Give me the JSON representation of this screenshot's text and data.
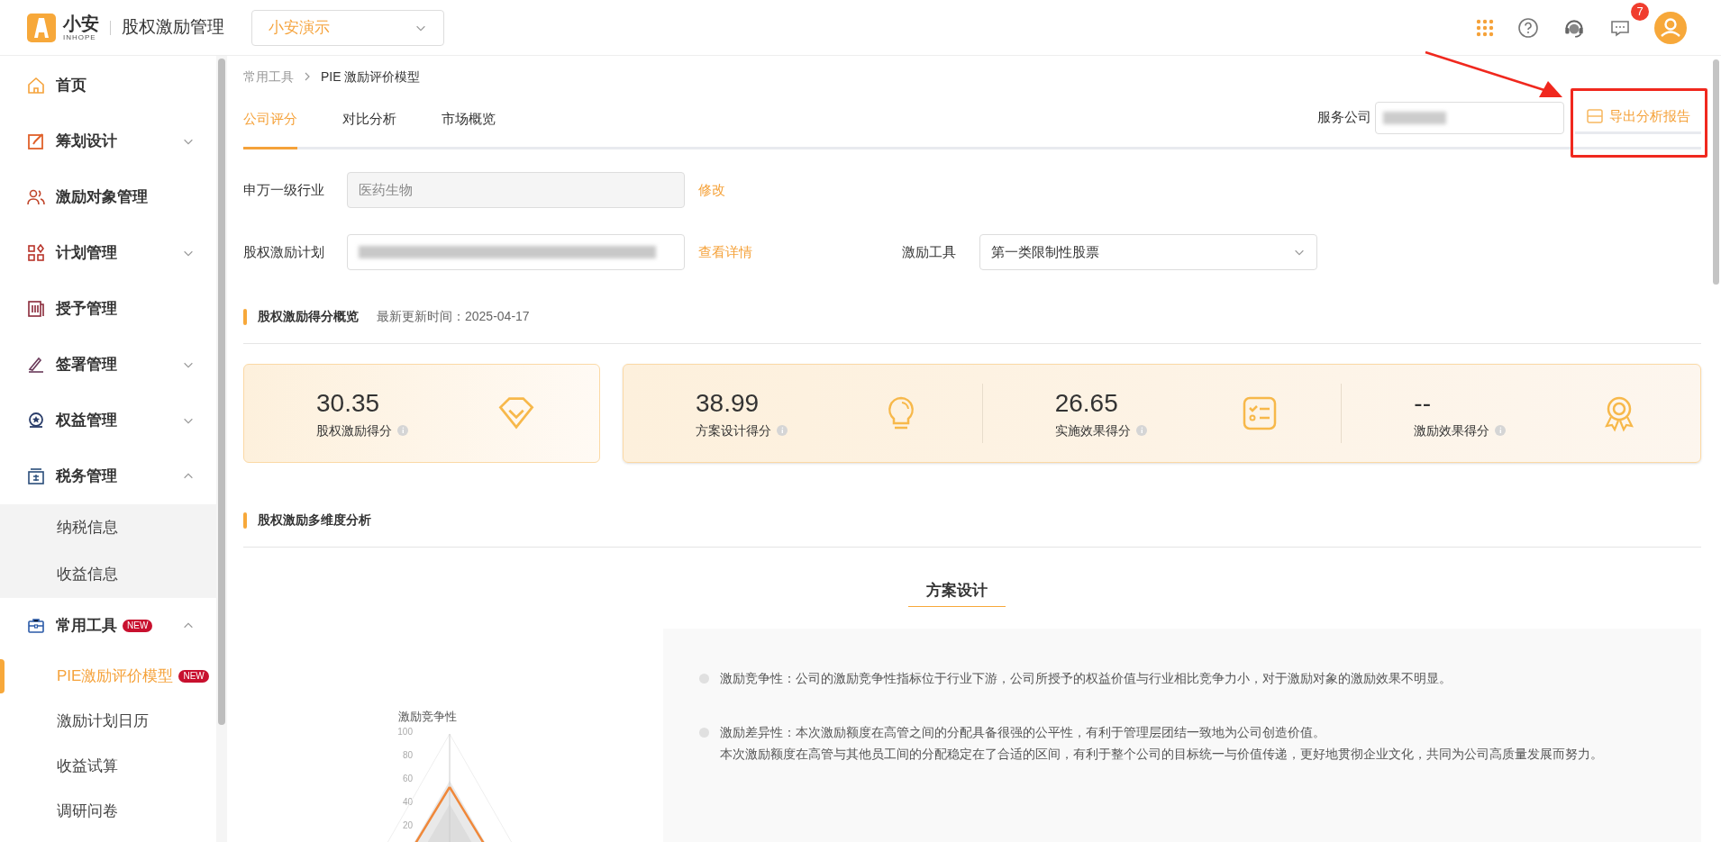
{
  "header": {
    "logo_text": "小安",
    "logo_subtext": "INHOPE",
    "app_title": "股权激励管理",
    "company_select": "小安演示",
    "message_count": "7"
  },
  "sidebar": {
    "items": [
      {
        "label": "首页",
        "selected": false
      },
      {
        "label": "筹划设计",
        "selected": false,
        "expanded": false
      },
      {
        "label": "激励对象管理",
        "selected": false
      },
      {
        "label": "计划管理",
        "selected": false,
        "expanded": false
      },
      {
        "label": "授予管理",
        "selected": false
      },
      {
        "label": "签署管理",
        "selected": false,
        "expanded": false
      },
      {
        "label": "权益管理",
        "selected": false,
        "expanded": false
      },
      {
        "label": "税务管理",
        "selected": false,
        "expanded": true,
        "children": [
          {
            "label": "纳税信息",
            "selected": false
          },
          {
            "label": "收益信息",
            "selected": false
          }
        ]
      },
      {
        "label": "常用工具",
        "selected": false,
        "expanded": true,
        "badge": "NEW",
        "children": [
          {
            "label": "PIE激励评价模型",
            "selected": true,
            "badge": "NEW"
          },
          {
            "label": "激励计划日历",
            "selected": false
          },
          {
            "label": "收益试算",
            "selected": false
          },
          {
            "label": "调研问卷",
            "selected": false
          }
        ]
      }
    ]
  },
  "breadcrumb": [
    "常用工具",
    "PIE 激励评价模型"
  ],
  "tabs": [
    {
      "label": "公司评分",
      "selected": true
    },
    {
      "label": "对比分析",
      "selected": false
    },
    {
      "label": "市场概览",
      "selected": false
    }
  ],
  "service_company": {
    "label": "服务公司"
  },
  "export_button": "导出分析报告",
  "form": {
    "industry": {
      "label": "申万一级行业",
      "value": "医药生物",
      "link": "修改"
    },
    "plan": {
      "label": "股权激励计划",
      "link": "查看详情"
    },
    "tool": {
      "label": "激励工具",
      "value": "第一类限制性股票"
    }
  },
  "overview": {
    "title": "股权激励得分概览",
    "updated": "最新更新时间：2025-04-17",
    "total": {
      "value": "30.35",
      "label": "股权激励得分"
    },
    "parts": [
      {
        "value": "38.99",
        "label": "方案设计得分",
        "kind": "bulb"
      },
      {
        "value": "26.65",
        "label": "实施效果得分",
        "kind": "checklist"
      },
      {
        "value": "--",
        "label": "激励效果得分",
        "kind": "medal"
      }
    ]
  },
  "analysis": {
    "title": "股权激励多维度分析",
    "subtitle": "方案设计",
    "radar": {
      "axis_label": "激励竞争性",
      "ticks": [
        "100",
        "80",
        "60",
        "40",
        "20"
      ]
    },
    "points": [
      {
        "lines": [
          "激励竞争性：公司的激励竞争性指标位于行业下游，公司所授予的权益价值与行业相比竞争力小，对于激励对象的激励效果不明显。"
        ]
      },
      {
        "lines": [
          "激励差异性：本次激励额度在高管之间的分配具备很强的公平性，有利于管理层团结一致地为公司创造价值。",
          "本次激励额度在高管与其他员工间的分配稳定在了合适的区间，有利于整个公司的目标统一与价值传递，更好地贯彻企业文化，共同为公司高质量发展而努力。"
        ]
      }
    ]
  }
}
